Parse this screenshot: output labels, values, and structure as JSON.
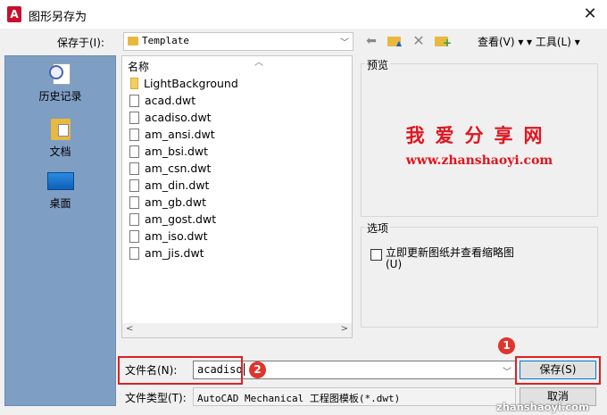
{
  "window": {
    "title": "图形另存为",
    "app_icon": "A"
  },
  "toolbar": {
    "save_in_label": "保存于(I):",
    "save_in_value": "Template",
    "view_menu": "查看(V)",
    "tools_menu": "工具(L)"
  },
  "places": [
    {
      "label": "历史记录",
      "icon": "history-icon"
    },
    {
      "label": "文档",
      "icon": "documents-icon"
    },
    {
      "label": "桌面",
      "icon": "desktop-icon"
    }
  ],
  "filelist": {
    "column_header": "名称",
    "items": [
      {
        "name": "LightBackground",
        "kind": "folder"
      },
      {
        "name": "acad.dwt",
        "kind": "file"
      },
      {
        "name": "acadiso.dwt",
        "kind": "file"
      },
      {
        "name": "am_ansi.dwt",
        "kind": "file"
      },
      {
        "name": "am_bsi.dwt",
        "kind": "file"
      },
      {
        "name": "am_csn.dwt",
        "kind": "file"
      },
      {
        "name": "am_din.dwt",
        "kind": "file"
      },
      {
        "name": "am_gb.dwt",
        "kind": "file"
      },
      {
        "name": "am_gost.dwt",
        "kind": "file"
      },
      {
        "name": "am_iso.dwt",
        "kind": "file"
      },
      {
        "name": "am_jis.dwt",
        "kind": "file"
      }
    ]
  },
  "preview": {
    "label": "预览",
    "watermark_cn": "我爱分享网",
    "watermark_url": "www.zhanshaoyi.com"
  },
  "options": {
    "label": "选项",
    "update_check_label": "立即更新图纸并查看缩略图(U)",
    "update_checked": false
  },
  "bottom": {
    "filename_label": "文件名(N):",
    "filename_value": "acadiso",
    "filetype_label": "文件类型(T):",
    "filetype_value": "AutoCAD Mechanical 工程图模板(*.dwt)",
    "save_button": "保存(S)",
    "cancel_button": "取消"
  },
  "annotations": {
    "badge_1": "1",
    "badge_2": "2"
  },
  "corner_watermark": "zhanshaoyi.com",
  "colors": {
    "highlight": "#e02020",
    "watermark": "#e0151d",
    "places_bg": "#7f9ec4"
  }
}
